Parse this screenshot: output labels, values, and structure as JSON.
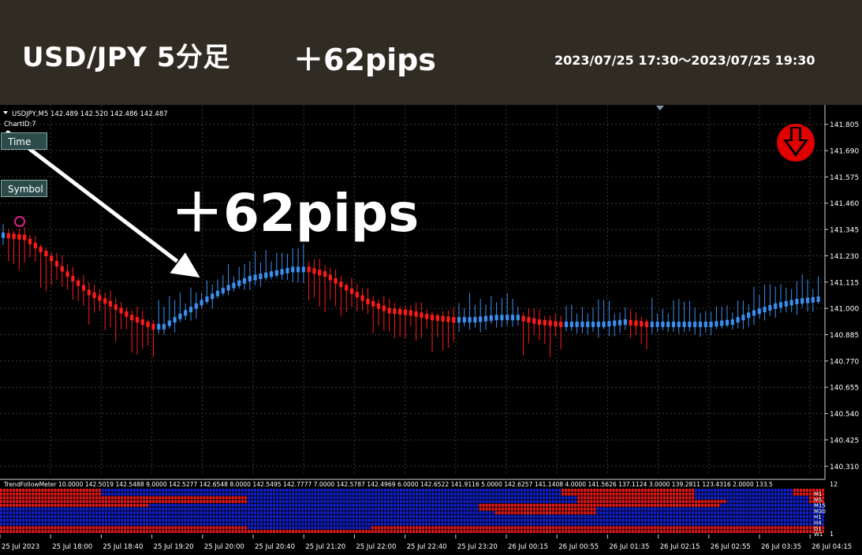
{
  "header": {
    "title": "USD/JPY 5分足",
    "pips": "＋62pips",
    "range": "2023/07/25 17:30～2023/07/25 19:30"
  },
  "chart": {
    "info_line": "USDJPY,M5  142.489 142.520 142.486 142.487",
    "chart_id": "ChartID:7",
    "buttons": {
      "time": "Time",
      "symbol": "Symbol"
    },
    "overlay_pips": "＋62pips",
    "colors": {
      "up": "#3a8fef",
      "down": "#ff1a1a",
      "arrow_badge": "#e00000",
      "grid": "#3a3a3a"
    }
  },
  "meter": {
    "label": "TrendFollowMeter 10.0000 142.5019 142.5488 9.0000 142.5277 142.6548 8.0000 142.5495 142.7777 7.0000 142.5787 142.4969 6.0000 142.6522 141.9116 5.0000 142.6257 141.1408 4.0000 141.5626 137.1124 3.0000 139.2811 123.4316 2.0000 133.5",
    "timeframes": [
      "M1",
      "M5",
      "M15",
      "M30",
      "H1",
      "H4",
      "D1",
      "W1"
    ],
    "scale_top": "12",
    "scale_bottom": "1",
    "colors": {
      "bull": "#1020d0",
      "bear": "#e81818"
    }
  },
  "chart_data": {
    "type": "candlestick",
    "symbol": "USDJPY",
    "timeframe": "M5",
    "y_ticks": [
      "141.805",
      "141.690",
      "141.575",
      "141.460",
      "141.345",
      "141.230",
      "141.115",
      "141.000",
      "140.885",
      "140.770",
      "140.655",
      "140.540",
      "140.425",
      "140.310"
    ],
    "ylim": [
      140.28,
      141.89
    ],
    "x_ticks": [
      "25 Jul 2023",
      "25 Jul 18:00",
      "25 Jul 18:40",
      "25 Jul 19:20",
      "25 Jul 20:00",
      "25 Jul 20:40",
      "25 Jul 21:20",
      "25 Jul 22:00",
      "25 Jul 22:40",
      "25 Jul 23:20",
      "26 Jul 00:15",
      "26 Jul 00:55",
      "26 Jul 01:35",
      "26 Jul 02:15",
      "26 Jul 02:55",
      "26 Jul 03:35",
      "26 Jul 04:15"
    ],
    "trend_path": [
      [
        0,
        141.32
      ],
      [
        4,
        141.31
      ],
      [
        8,
        141.24
      ],
      [
        12,
        141.15
      ],
      [
        16,
        141.07
      ],
      [
        20,
        141.02
      ],
      [
        24,
        140.96
      ],
      [
        28,
        140.92
      ],
      [
        30,
        140.92
      ],
      [
        34,
        140.98
      ],
      [
        38,
        141.04
      ],
      [
        42,
        141.09
      ],
      [
        46,
        141.13
      ],
      [
        50,
        141.15
      ],
      [
        54,
        141.17
      ],
      [
        57,
        141.17
      ],
      [
        60,
        141.15
      ],
      [
        64,
        141.09
      ],
      [
        68,
        141.03
      ],
      [
        72,
        140.99
      ],
      [
        76,
        140.98
      ],
      [
        80,
        140.96
      ],
      [
        84,
        140.95
      ],
      [
        88,
        140.95
      ],
      [
        92,
        140.96
      ],
      [
        96,
        140.96
      ],
      [
        100,
        140.94
      ],
      [
        104,
        140.93
      ],
      [
        108,
        140.93
      ],
      [
        112,
        140.93
      ],
      [
        116,
        140.94
      ],
      [
        120,
        140.93
      ],
      [
        124,
        140.93
      ],
      [
        128,
        140.93
      ],
      [
        132,
        140.93
      ],
      [
        136,
        140.94
      ],
      [
        140,
        140.98
      ],
      [
        144,
        141.01
      ],
      [
        148,
        141.03
      ],
      [
        152,
        141.04
      ]
    ]
  }
}
